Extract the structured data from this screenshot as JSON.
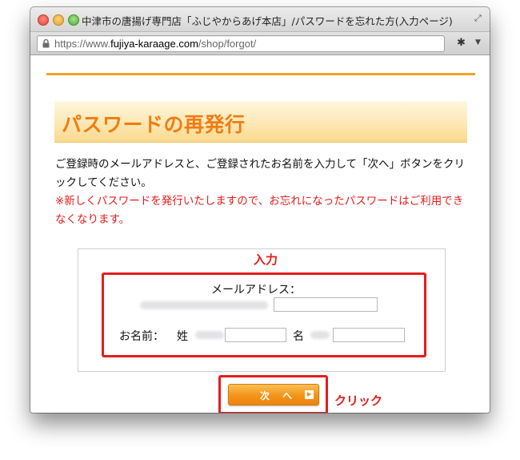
{
  "window": {
    "title": "中津市の唐揚げ専門店「ふじやからあげ本店」/パスワードを忘れた方(入力ページ)"
  },
  "toolbar": {
    "url_prefix": "https://www.",
    "url_domain": "fujiya-karaage.com",
    "url_path": "/shop/forgot/"
  },
  "page": {
    "heading": "パスワードの再発行",
    "description": "ご登録時のメールアドレスと、ご登録されたお名前を入力して「次へ」ボタンをクリックしてください。",
    "warning": "※新しくパスワードを発行いたしますので、お忘れになったパスワードはご利用できなくなります。"
  },
  "form": {
    "annotation_input": "入力",
    "email_label": "メールアドレス：",
    "email_value": "",
    "name_label": "お名前：",
    "sei_label": "姓",
    "sei_value": "",
    "mei_label": "名",
    "mei_value": ""
  },
  "actions": {
    "next_label": "次 へ",
    "annotation_click": "クリック"
  },
  "icons": {
    "lock": "lock-icon",
    "fullscreen": "fullscreen-icon",
    "extension": "extension-icon",
    "next_arrow": "arrow-right-icon"
  },
  "colors": {
    "accent_orange": "#f07d12",
    "rule_orange": "#f3a324",
    "warning_red": "#e51c1c"
  }
}
